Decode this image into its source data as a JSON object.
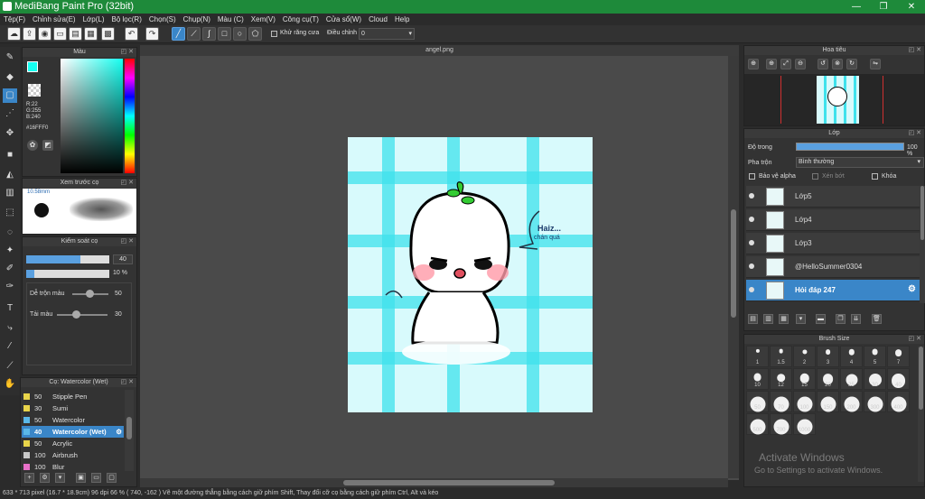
{
  "window": {
    "title": "MediBang Paint Pro (32bit)",
    "minimize": "—",
    "maximize": "❐",
    "close": "✕"
  },
  "menu": [
    "Tệp(F)",
    "Chỉnh sửa(E)",
    "Lớp(L)",
    "Bộ lọc(R)",
    "Chọn(S)",
    "Chụp(N)",
    "Màu (C)",
    "Xem(V)",
    "Công cụ(T)",
    "Cửa sổ(W)",
    "Cloud",
    "Help"
  ],
  "toolbar": {
    "antialias_label": "Khử răng cưa",
    "adjust_label": "Điều chỉnh",
    "adjust_value": "0"
  },
  "color_panel": {
    "title": "Màu",
    "r": "R:22",
    "g": "G:255",
    "b": "B:240",
    "hex": "#16FFF0"
  },
  "brush_preview": {
    "title": "Xem trước cọ",
    "size": "10.58mm"
  },
  "brush_control": {
    "title": "Kiểm soát cọ",
    "size_value": "40",
    "opacity_value": "10 %",
    "blend_label": "Dễ trộn màu",
    "blend_value": "50",
    "load_label": "Tải màu",
    "load_value": "30"
  },
  "brush_list": {
    "title": "Cọ: Watercolor (Wet)",
    "items": [
      {
        "size": "50",
        "name": "Stipple Pen",
        "color": "#e8d44a"
      },
      {
        "size": "30",
        "name": "Sumi",
        "color": "#e8d44a"
      },
      {
        "size": "50",
        "name": "Watercolor",
        "color": "#5ab8e8"
      },
      {
        "size": "40",
        "name": "Watercolor (Wet)",
        "color": "#5ab8e8"
      },
      {
        "size": "50",
        "name": "Acrylic",
        "color": "#e8d44a"
      },
      {
        "size": "100",
        "name": "Airbrush",
        "color": "#c8c8c8"
      },
      {
        "size": "100",
        "name": "Blur",
        "color": "#e870c8"
      }
    ]
  },
  "document": {
    "tab": "angel.png",
    "speech": "Haiz...",
    "speech2": "chán quá"
  },
  "navigator": {
    "title": "Hoa tiêu"
  },
  "layers": {
    "title": "Lớp",
    "opacity_label": "Độ trong",
    "opacity_value": "100 %",
    "blend_label": "Pha trộn",
    "blend_value": "Bình thường",
    "protect_alpha": "Bảo vệ alpha",
    "clip": "Xén bớt",
    "lock": "Khóa",
    "items": [
      {
        "name": "Lớp5"
      },
      {
        "name": "Lớp4"
      },
      {
        "name": "Lớp3"
      },
      {
        "name": "@HelloSummer0304"
      },
      {
        "name": "Hỏi đáp 247"
      }
    ]
  },
  "brush_size": {
    "title": "Brush Size",
    "sizes": [
      "1",
      "1.5",
      "2",
      "3",
      "4",
      "5",
      "7",
      "10",
      "12",
      "15",
      "20",
      "25",
      "30",
      "40",
      "50",
      "70",
      "100",
      "150",
      "200",
      "300",
      "400",
      "500",
      "700",
      "1000"
    ]
  },
  "watermark": {
    "line1": "Activate Windows",
    "line2": "Go to Settings to activate Windows."
  },
  "status": "633 * 713 pixel   (16.7 * 18.9cm)   96 dpi   66 %   ( 740, -162 )   Vẽ một đường thẳng bằng cách giữ phím Shift, Thay đổi cỡ cọ bằng cách giữ phím Ctrl, Alt và kéo"
}
